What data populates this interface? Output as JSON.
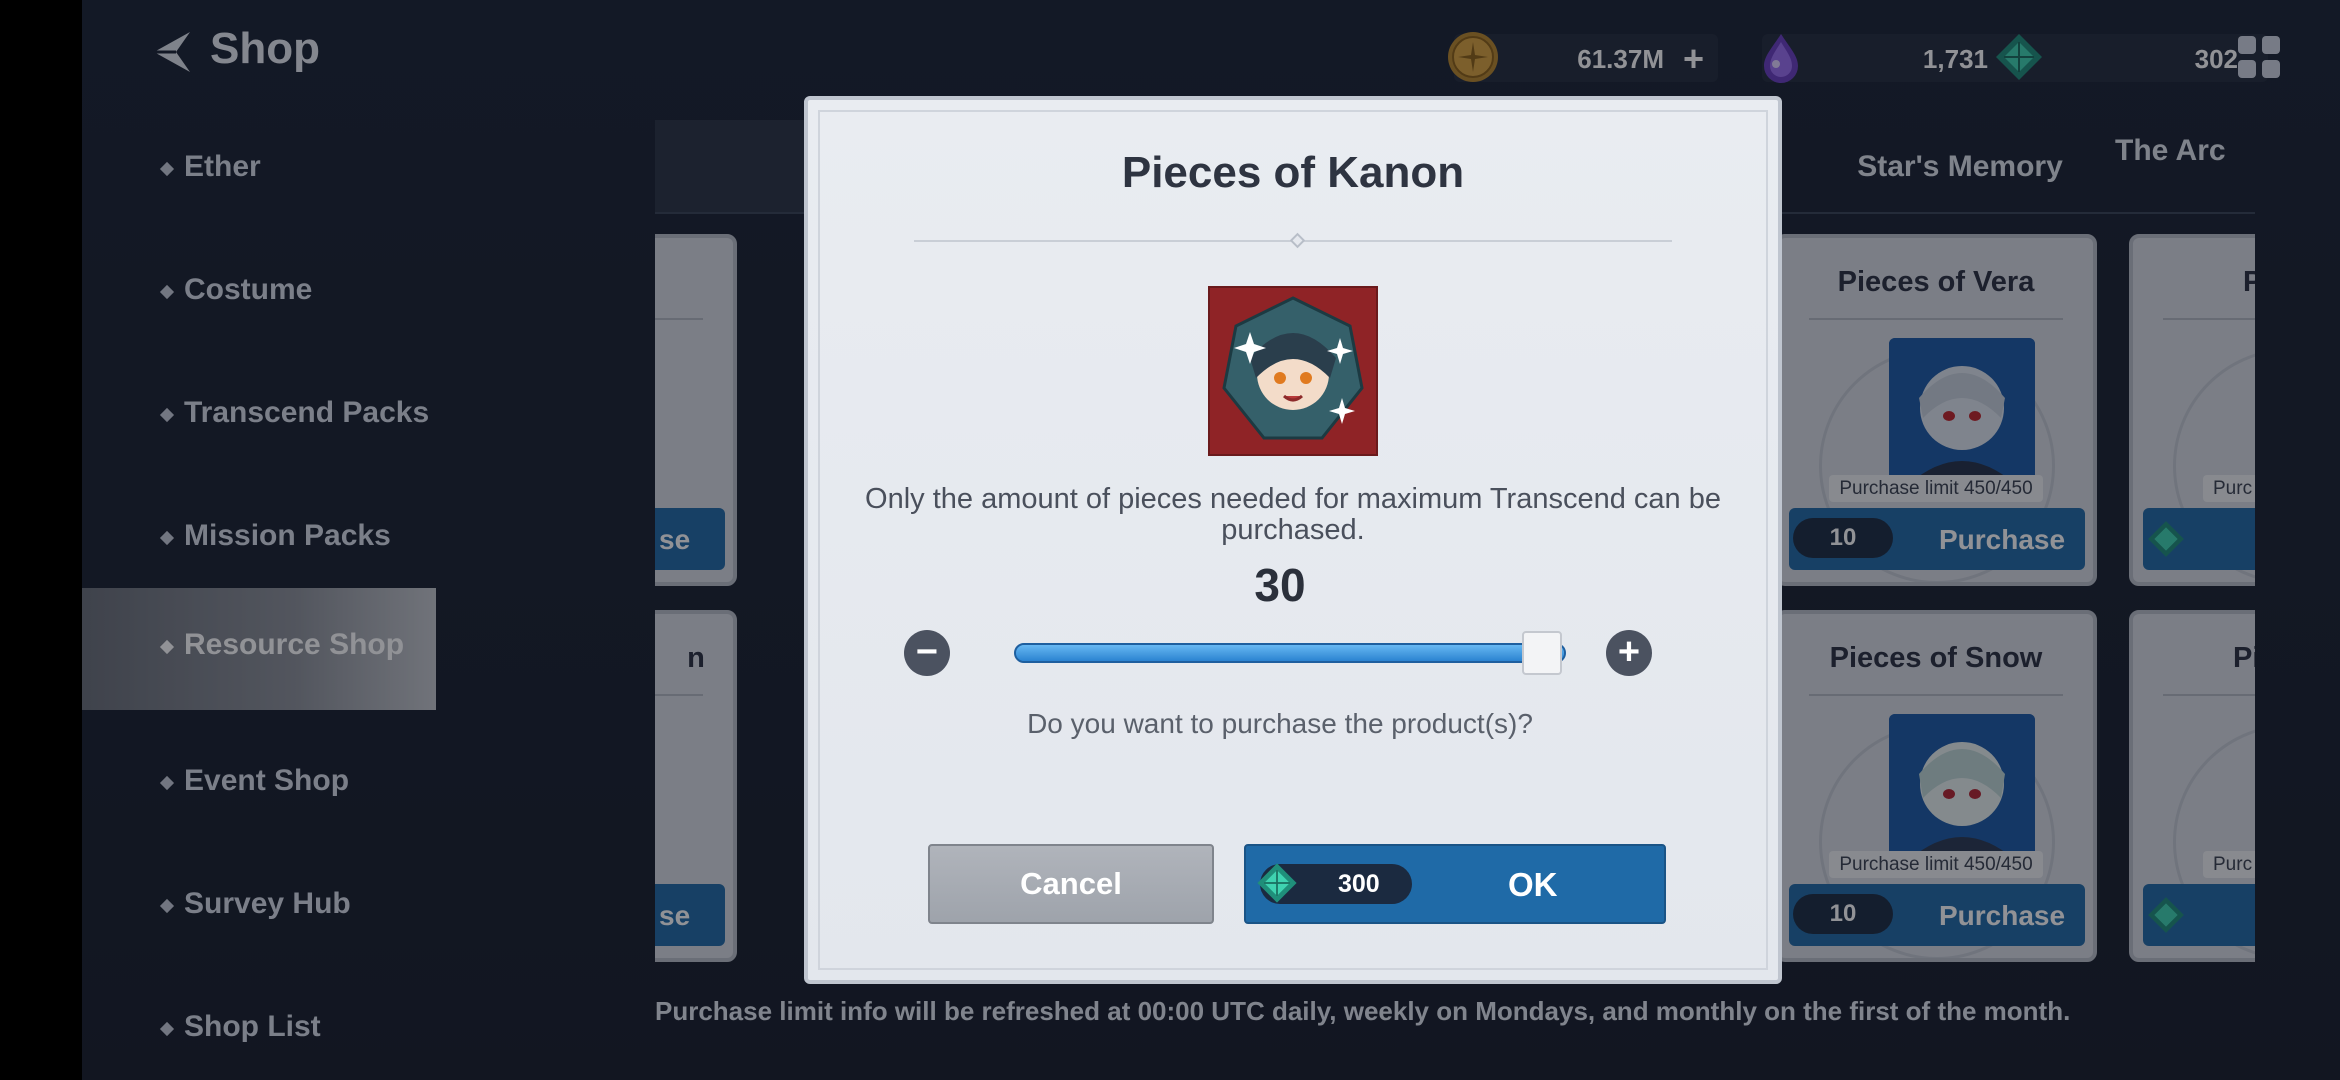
{
  "header": {
    "title": "Shop",
    "currencies": [
      {
        "name": "gold",
        "value": "61.37M",
        "plus": "+"
      },
      {
        "name": "ether",
        "value": "1,731",
        "plus": "+"
      },
      {
        "name": "gem",
        "value": "302"
      }
    ]
  },
  "sidebar": {
    "items": [
      {
        "label": "Ether"
      },
      {
        "label": "Costume"
      },
      {
        "label": "Transcend Packs"
      },
      {
        "label": "Mission Packs"
      },
      {
        "label": "Resource Shop",
        "active": true
      },
      {
        "label": "Event Shop"
      },
      {
        "label": "Survey Hub"
      },
      {
        "label": "Shop List"
      }
    ]
  },
  "tabs": [
    {
      "label": "Star's Memory"
    },
    {
      "label": "The Arc R"
    }
  ],
  "cards": [
    {
      "title": "Pieces of Vera",
      "limit": "Purchase limit 450/450",
      "qty": "10",
      "button": "Purchase"
    },
    {
      "title": "Pieces of Snow",
      "limit": "Purchase limit 450/450",
      "qty": "10",
      "button": "Purchase"
    },
    {
      "partial_title_1": "P",
      "partial_title_2": "Pi",
      "partial_limit": "Purc",
      "partial_left_buy": "se",
      "partial_left_title": "n"
    }
  ],
  "footer_note": "Purchase limit info will be refreshed at 00:00 UTC daily, weekly on Mondays, and monthly on the first of the month.",
  "modal": {
    "title": "Pieces of Kanon",
    "info": "Only the amount of pieces needed for maximum Transcend can be purchased.",
    "count": "30",
    "slider_fraction": 1.0,
    "minus": "−",
    "plus": "+",
    "question": "Do you want to purchase the product(s)?",
    "cancel_label": "Cancel",
    "price": "300",
    "ok_label": "OK"
  },
  "colors": {
    "accent_blue": "#226aa6",
    "background": "#1b2333",
    "modal_bg": "#e9ecf1"
  }
}
